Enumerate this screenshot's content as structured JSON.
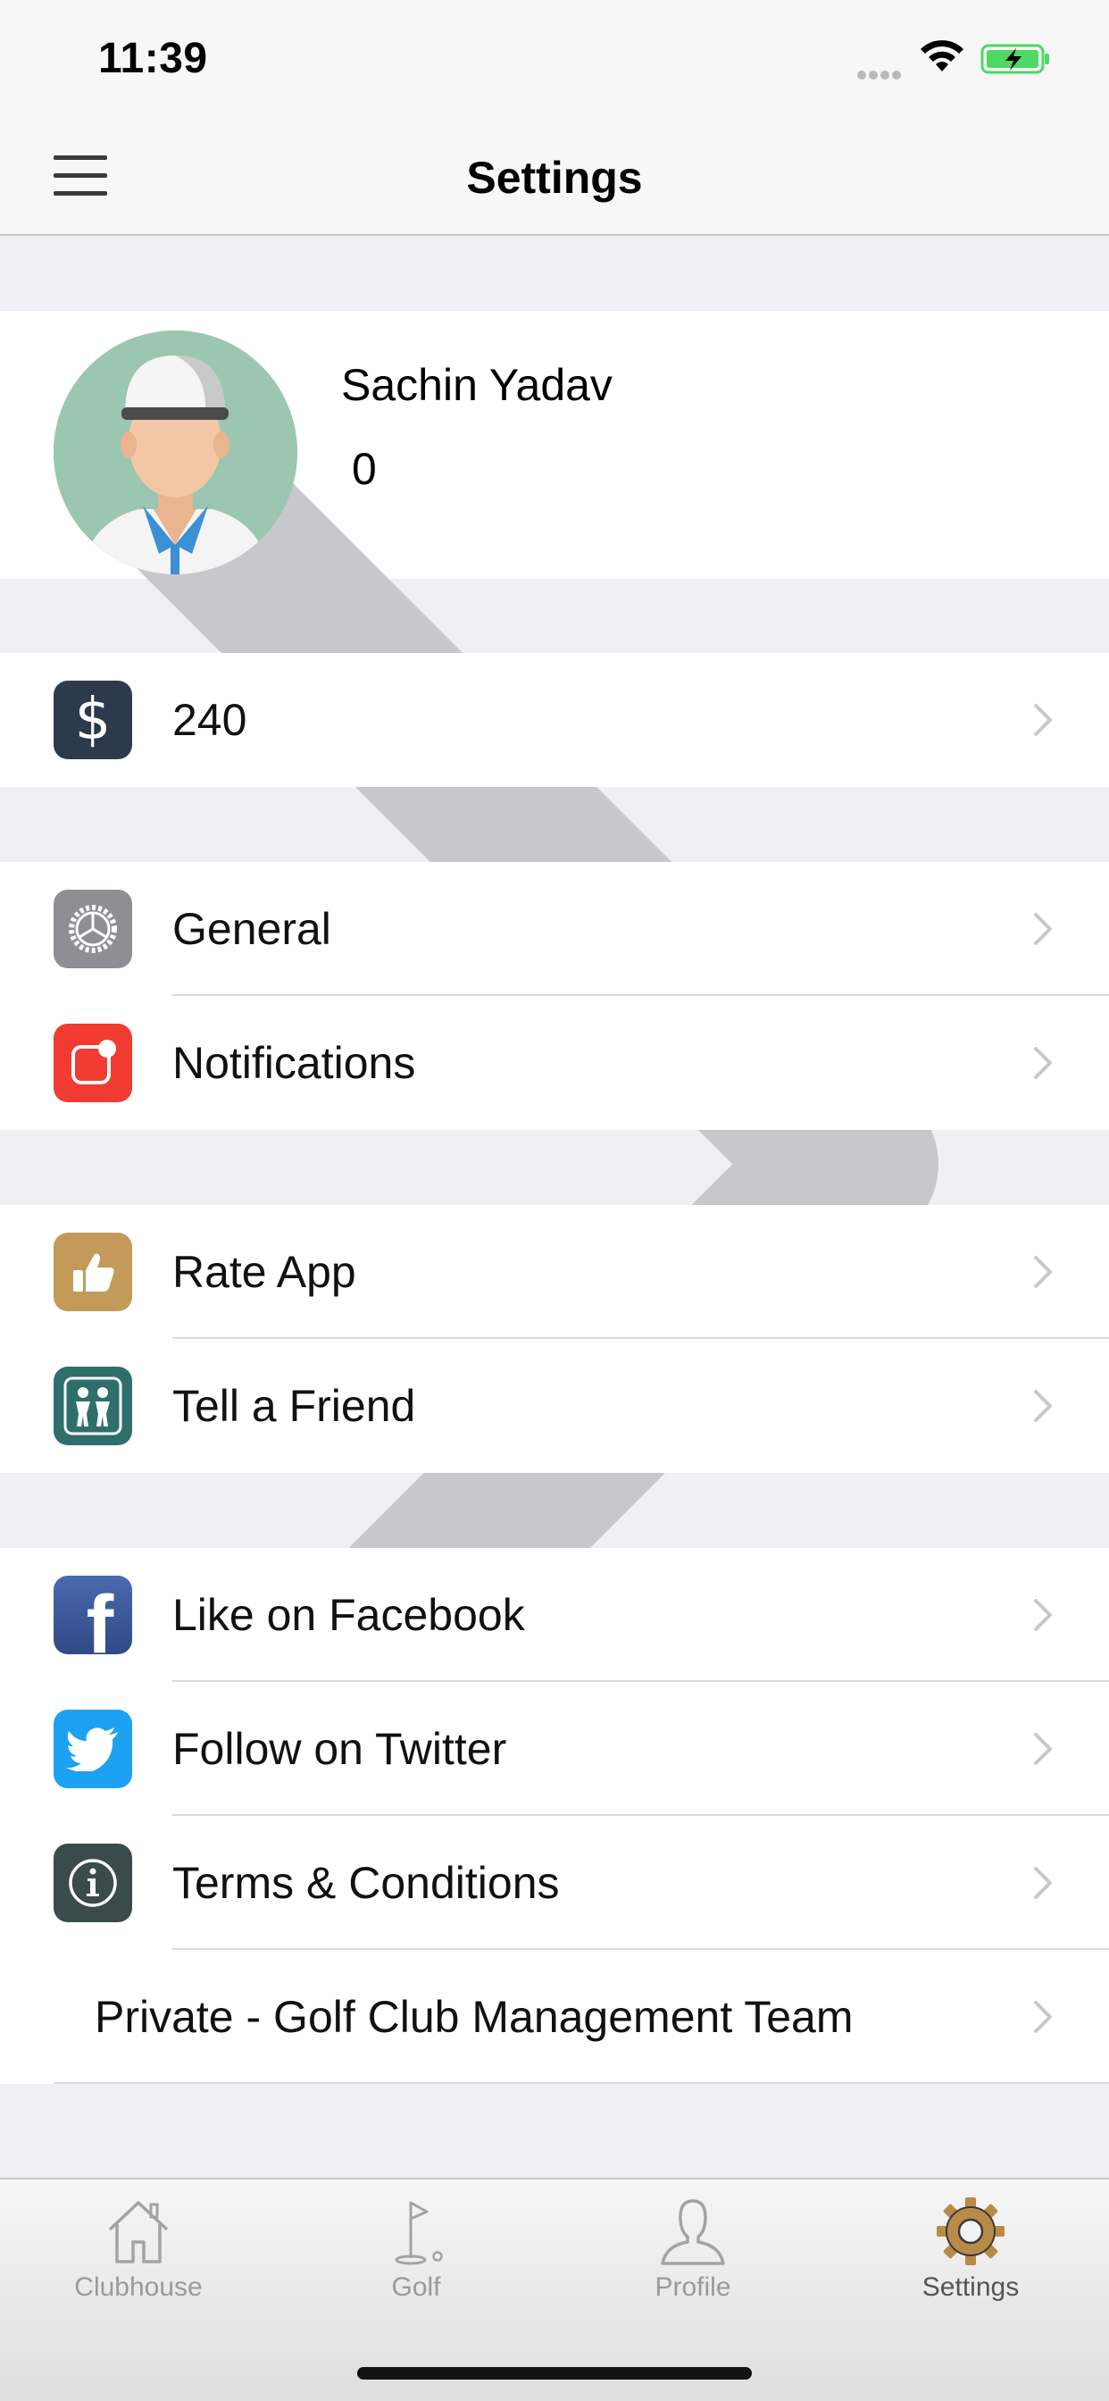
{
  "status_bar": {
    "time": "11:39"
  },
  "nav": {
    "title": "Settings"
  },
  "profile": {
    "name": "Sachin  Yadav",
    "value": "0"
  },
  "balance": {
    "amount": "240"
  },
  "menu": {
    "general": "General",
    "notifications": "Notifications",
    "rate_app": "Rate App",
    "tell_friend": "Tell a Friend",
    "facebook": "Like on Facebook",
    "twitter": "Follow on Twitter",
    "terms": "Terms & Conditions",
    "private": "Private - Golf Club Management Team"
  },
  "tabs": [
    {
      "label": "Clubhouse",
      "icon": "house-icon"
    },
    {
      "label": "Golf",
      "icon": "golf-flag-icon"
    },
    {
      "label": "Profile",
      "icon": "person-icon"
    },
    {
      "label": "Settings",
      "icon": "gear-icon",
      "active": true
    }
  ],
  "colors": {
    "dollar_icon": "#2d3a4e",
    "general_icon": "#8e8e93",
    "notifications_icon": "#f23b33",
    "rate_icon": "#c49a5a",
    "friend_icon": "#2f6f6b",
    "facebook_icon": "#3b5998",
    "twitter_icon": "#1da1f2",
    "terms_icon": "#3b4a4a",
    "active_tab_icon": "#b98a48"
  }
}
